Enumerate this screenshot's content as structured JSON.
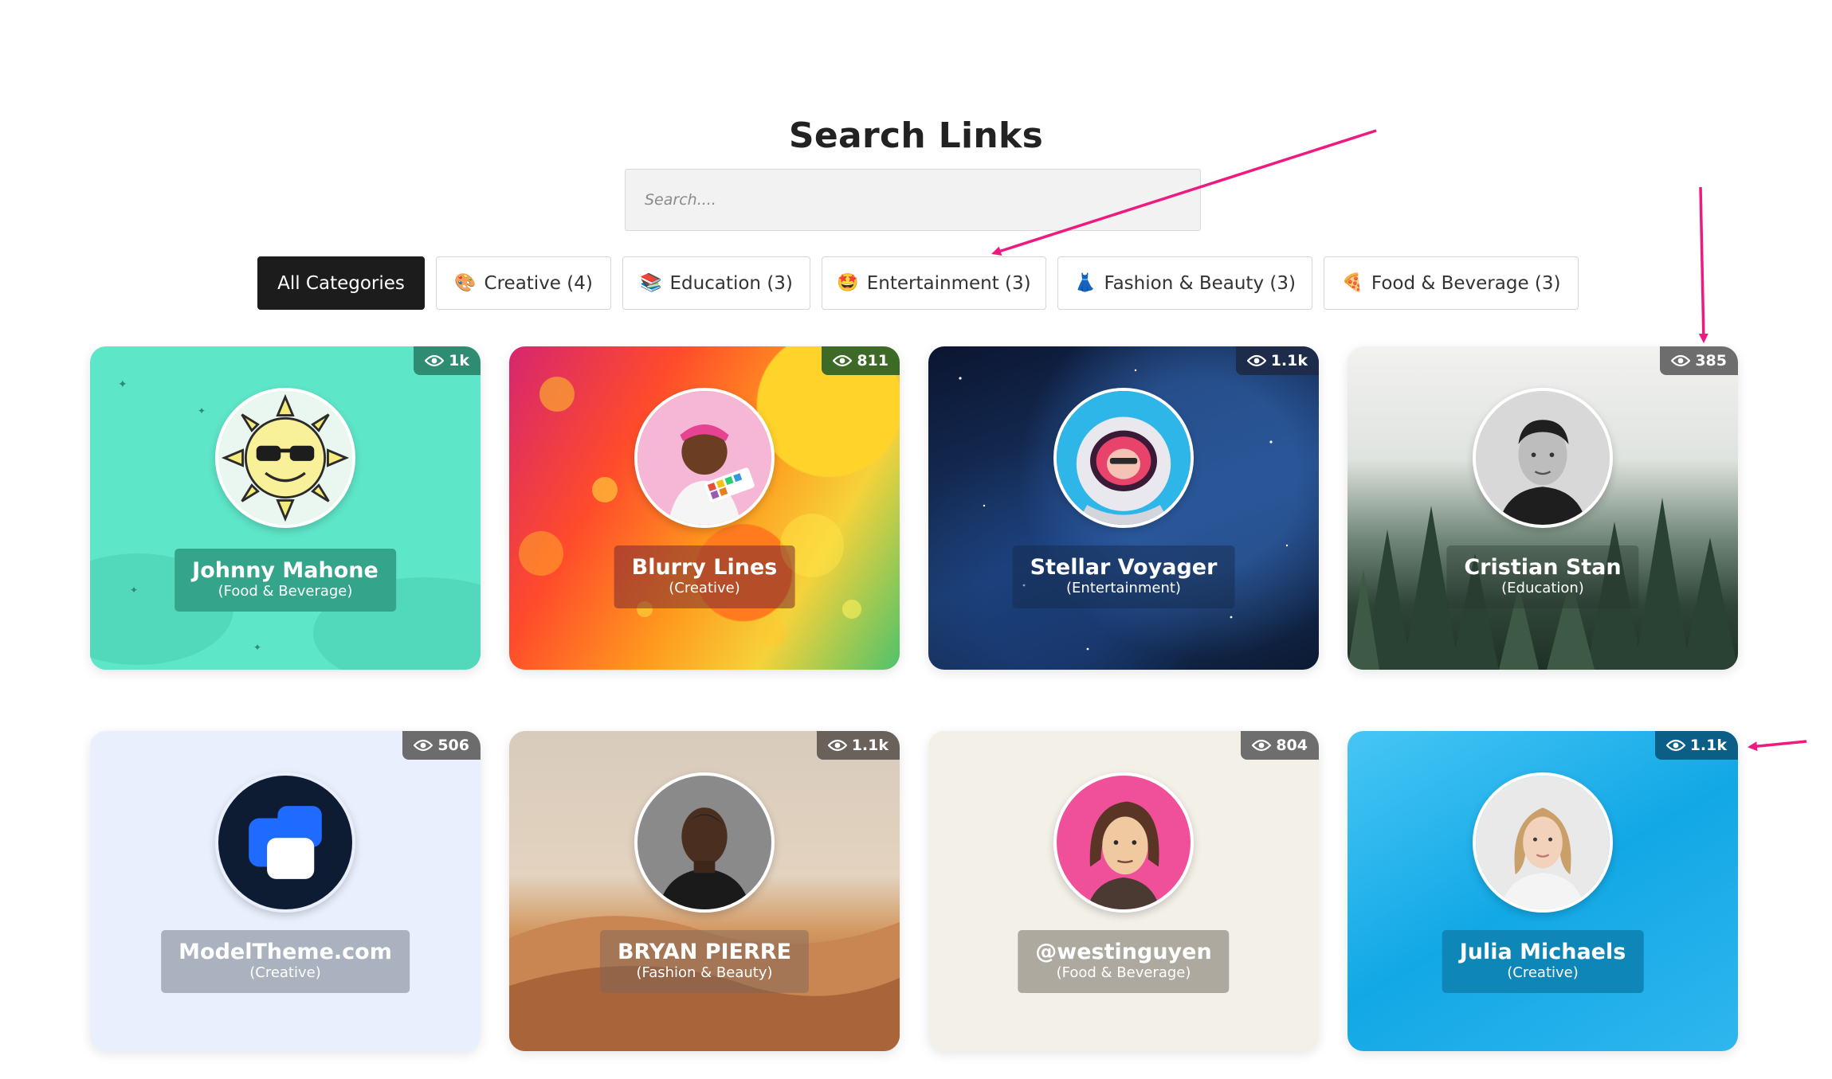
{
  "page": {
    "title": "Search Links"
  },
  "search": {
    "placeholder": "Search...."
  },
  "categories": [
    {
      "label": "All Categories",
      "emoji": "",
      "active": true
    },
    {
      "label": "Creative (4)",
      "emoji": "🎨"
    },
    {
      "label": "Education (3)",
      "emoji": "📚"
    },
    {
      "label": "Entertainment (3)",
      "emoji": "🤩"
    },
    {
      "label": "Fashion & Beauty (3)",
      "emoji": "👗"
    },
    {
      "label": "Food & Beverage (3)",
      "emoji": "🍕"
    }
  ],
  "cards": [
    {
      "name": "Johnny Mahone",
      "category": "(Food & Beverage)",
      "views": "1k"
    },
    {
      "name": "Blurry Lines",
      "category": "(Creative)",
      "views": "811"
    },
    {
      "name": "Stellar Voyager",
      "category": "(Entertainment)",
      "views": "1.1k"
    },
    {
      "name": "Cristian Stan",
      "category": "(Education)",
      "views": "385"
    },
    {
      "name": "ModelTheme.com",
      "category": "(Creative)",
      "views": "506"
    },
    {
      "name": "BRYAN PIERRE",
      "category": "(Fashion & Beauty)",
      "views": "1.1k"
    },
    {
      "name": "@westinguyen",
      "category": "(Food & Beverage)",
      "views": "804"
    },
    {
      "name": "Julia Michaels",
      "category": "(Creative)",
      "views": "1.1k"
    }
  ],
  "icons": {
    "views": "eye-icon"
  },
  "colors": {
    "annotation_arrow": "#ee1a80",
    "active_category": "#1c1c1c"
  }
}
